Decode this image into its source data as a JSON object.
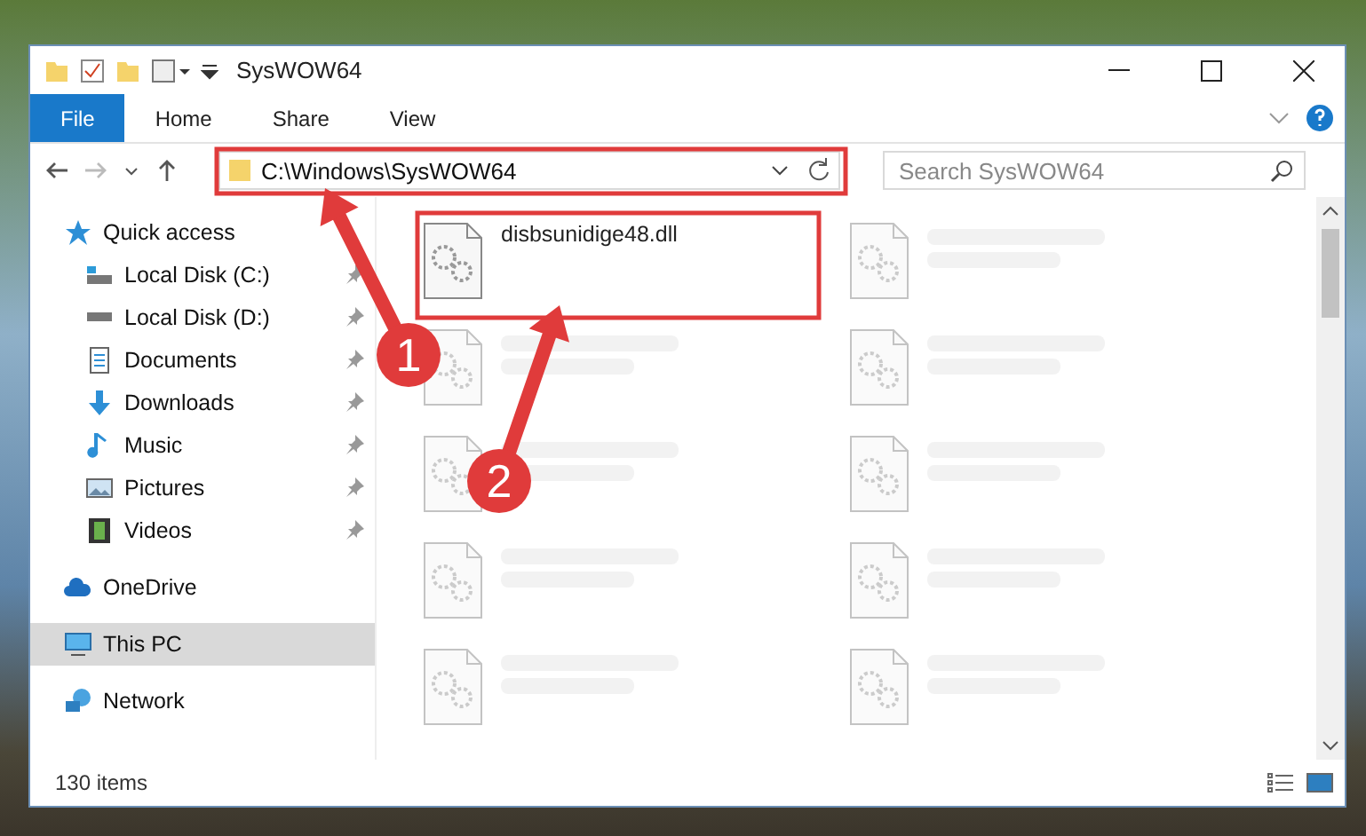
{
  "window": {
    "title": "SysWOW64"
  },
  "ribbon": {
    "tabs": [
      {
        "label": "File",
        "kind": "file"
      },
      {
        "label": "Home",
        "kind": "tab"
      },
      {
        "label": "Share",
        "kind": "tab"
      },
      {
        "label": "View",
        "kind": "tab"
      }
    ]
  },
  "address_bar": {
    "path": "C:\\Windows\\SysWOW64",
    "search": {
      "placeholder": "Search SysWOW64"
    }
  },
  "sidebar": {
    "items": [
      {
        "label": "Quick access",
        "kind": "star",
        "selected": false,
        "children": [
          {
            "label": "Local Disk (C:)",
            "kind": "drive-c",
            "pinned": true
          },
          {
            "label": "Local Disk (D:)",
            "kind": "drive",
            "pinned": true
          },
          {
            "label": "Documents",
            "kind": "documents",
            "pinned": true
          },
          {
            "label": "Downloads",
            "kind": "downloads",
            "pinned": true
          },
          {
            "label": "Music",
            "kind": "music",
            "pinned": true
          },
          {
            "label": "Pictures",
            "kind": "pictures",
            "pinned": true
          },
          {
            "label": "Videos",
            "kind": "videos",
            "pinned": true
          }
        ]
      },
      {
        "label": "OneDrive",
        "kind": "cloud",
        "selected": false
      },
      {
        "label": "This PC",
        "kind": "computer",
        "selected": true
      },
      {
        "label": "Network",
        "kind": "network",
        "selected": false
      }
    ]
  },
  "files": [
    {
      "name": "disbsunidige48.dll",
      "blurred": false
    },
    {
      "blurred": true
    },
    {
      "blurred": true
    },
    {
      "blurred": true
    },
    {
      "blurred": true
    },
    {
      "blurred": true
    },
    {
      "blurred": true
    },
    {
      "blurred": true
    },
    {
      "blurred": true
    },
    {
      "blurred": true
    }
  ],
  "status_bar": {
    "item_count": "130 items"
  },
  "annotations": [
    {
      "label": "1"
    },
    {
      "label": "2"
    }
  ]
}
